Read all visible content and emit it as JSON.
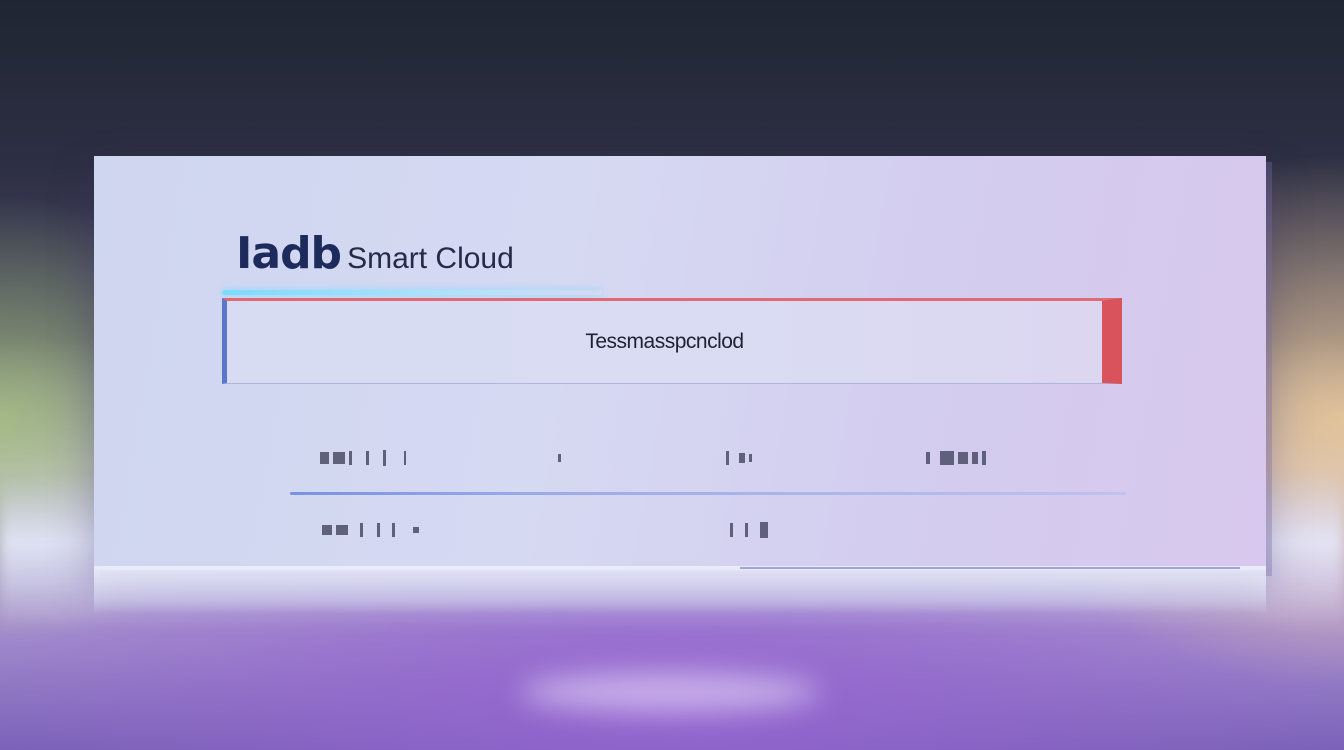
{
  "brand": {
    "logo_text": "Iadb",
    "name": "Smart Cloud"
  },
  "message_box": {
    "text": "Tessmasspcnclod"
  },
  "colors": {
    "panel": "#d4d8f1",
    "accent_red": "#d9535c",
    "accent_blue": "#5a78c8",
    "glow": "#78dcff",
    "brand_text": "#1d2a5c"
  }
}
